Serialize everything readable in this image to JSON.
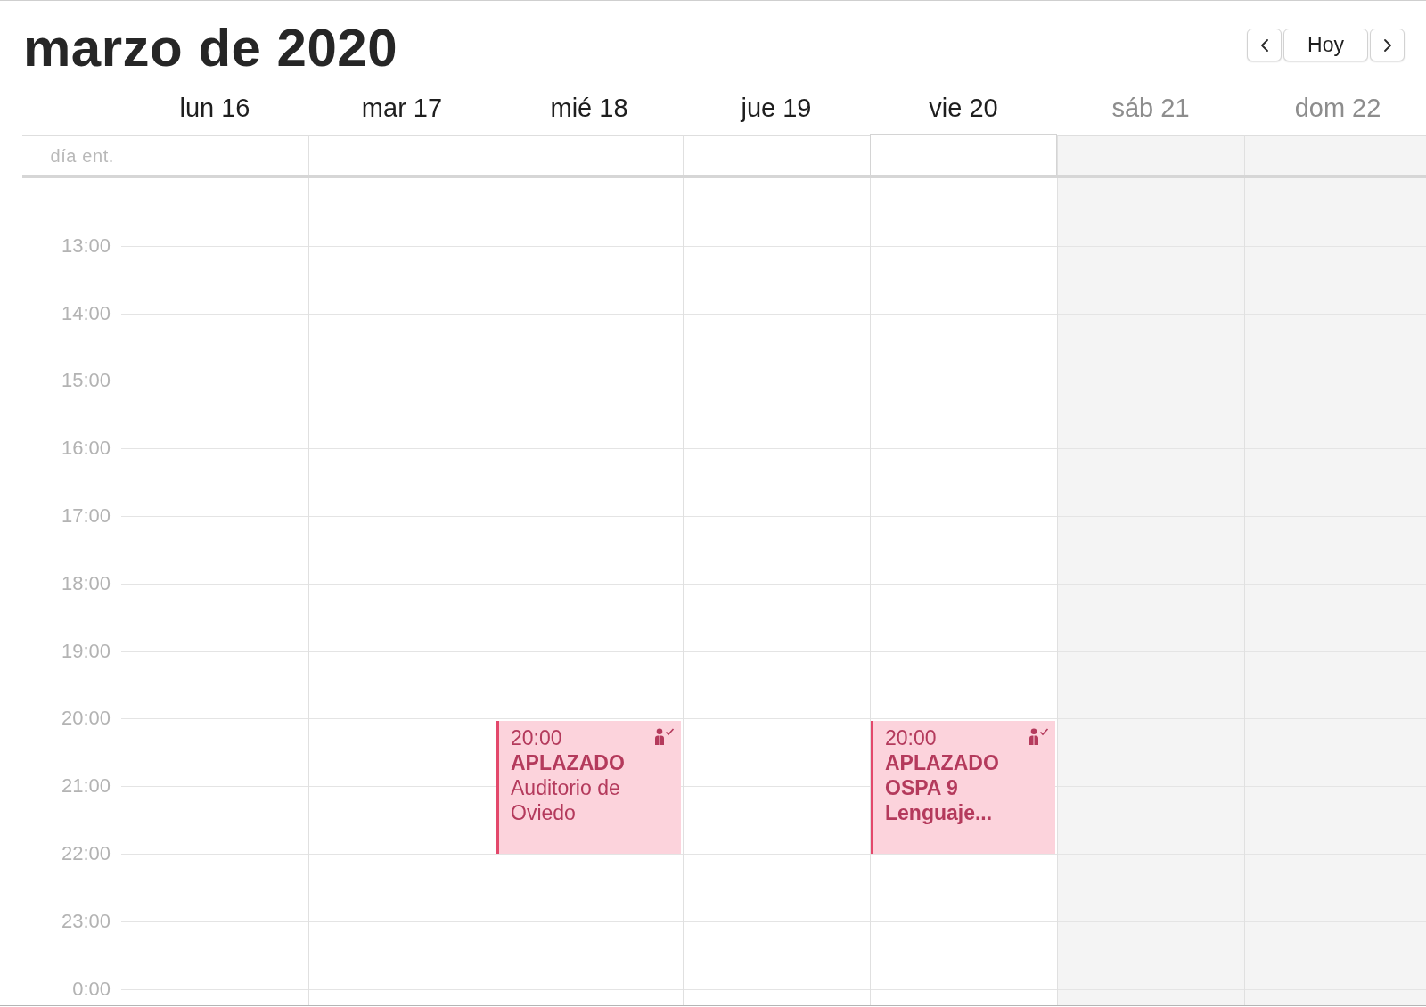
{
  "title": "marzo de 2020",
  "navigation": {
    "today": "Hoy"
  },
  "all_day_label": "día ent.",
  "days": [
    {
      "label": "lun 16",
      "weekend": false,
      "selected": false
    },
    {
      "label": "mar 17",
      "weekend": false,
      "selected": false
    },
    {
      "label": "mié 18",
      "weekend": false,
      "selected": false,
      "events": [
        {
          "time": "20:00",
          "title": "APLAZADO",
          "location": "Auditorio de Oviedo"
        }
      ]
    },
    {
      "label": "jue 19",
      "weekend": false,
      "selected": false
    },
    {
      "label": "vie 20",
      "weekend": false,
      "selected": true,
      "events": [
        {
          "time": "20:00",
          "title": "APLAZADO OSPA 9 Lenguaje..."
        }
      ]
    },
    {
      "label": "sáb 21",
      "weekend": true,
      "selected": false
    },
    {
      "label": "dom 22",
      "weekend": true,
      "selected": false
    }
  ],
  "hours": [
    "13:00",
    "14:00",
    "15:00",
    "16:00",
    "17:00",
    "18:00",
    "19:00",
    "20:00",
    "21:00",
    "22:00",
    "23:00",
    "0:00"
  ]
}
